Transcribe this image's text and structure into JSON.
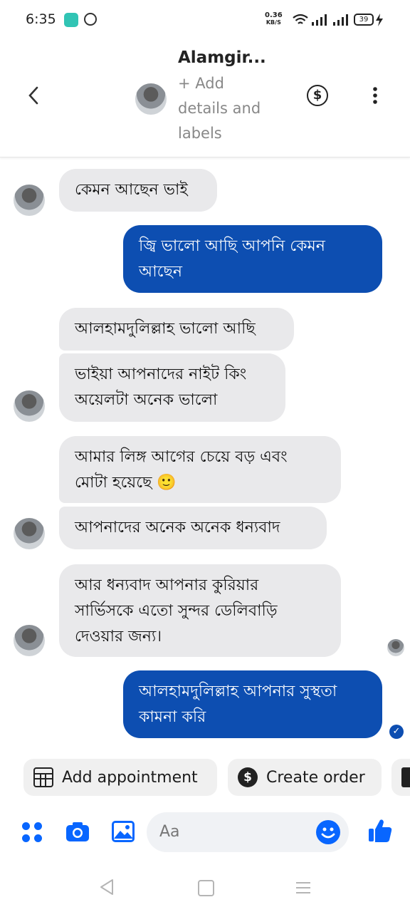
{
  "status_bar": {
    "time": "6:35",
    "net_speed_value": "0.36",
    "net_speed_unit": "KB/S",
    "battery": "39"
  },
  "header": {
    "contact_name": "Alamgir...",
    "subtitle": "+ Add details and labels",
    "icons": [
      "back-arrow-icon",
      "dollar-circle-icon",
      "more-vertical-icon"
    ]
  },
  "messages": [
    {
      "side": "in",
      "text": "কেমন আছেন ভাই"
    },
    {
      "side": "out",
      "text": "জ্বি ভালো আছি আপনি কেমন আছেন"
    },
    {
      "side": "in",
      "text": "আলহামদুলিল্লাহ ভালো আছি"
    },
    {
      "side": "in",
      "text": "ভাইয়া আপনাদের নাইট কিং অয়েলটা অনেক ভালো"
    },
    {
      "side": "in",
      "text": "আমার লিঙ্গ আগের চেয়ে বড় এবং মোটা হয়েছে 🙂"
    },
    {
      "side": "in",
      "text": "আপনাদের অনেক অনেক ধন্যবাদ"
    },
    {
      "side": "in",
      "text": "আর ধন্যবাদ আপনার কুরিয়ার সার্ভিসকে এতো সুন্দর ডেলিবাড়ি দেওয়ার জন্য।"
    },
    {
      "side": "out",
      "text": "আলহামদুলিল্লাহ আপনার সুস্থতা কামনা করি"
    }
  ],
  "quick_actions": {
    "add_appointment": "Add appointment",
    "create_order": "Create order"
  },
  "composer": {
    "placeholder": "Aa"
  },
  "colors": {
    "outgoing_bubble": "#0d4eb1",
    "incoming_bubble": "#e9e9eb",
    "accent": "#0866ff"
  }
}
